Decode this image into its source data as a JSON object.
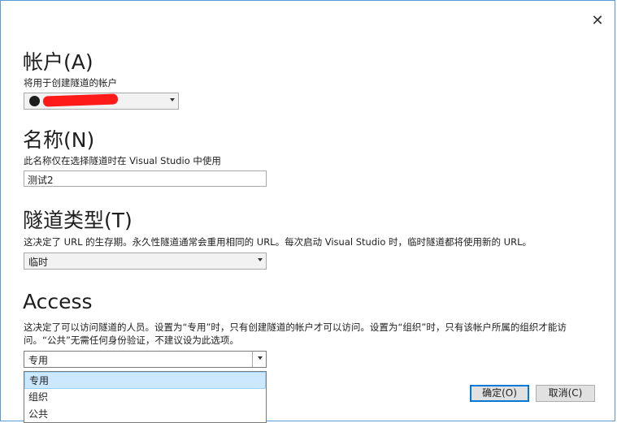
{
  "window": {
    "close_glyph": "✕"
  },
  "account": {
    "title": "帐户(A)",
    "desc": "将用于创建隧道的帐户",
    "value": "",
    "icon": "github-icon"
  },
  "name": {
    "title": "名称(N)",
    "desc": "此名称仅在选择隧道时在 Visual Studio 中使用",
    "value": "测试2"
  },
  "tunnel_type": {
    "title": "隧道类型(T)",
    "desc": "这决定了 URL 的生存期。永久性隧道通常会重用相同的 URL。每次启动 Visual Studio 时，临时隧道都将使用新的 URL。",
    "value": "临时"
  },
  "access": {
    "title": "Access",
    "desc_line1": "这决定了可以访问隧道的人员。设置为“专用”时，只有创建隧道的帐户才可以访问。设置为“组织”时，只有该帐户所属的组织才能访",
    "desc_line2": "问。“公共”无需任何身份验证，不建议设为此选项。",
    "value": "专用",
    "options": [
      "专用",
      "组织",
      "公共"
    ]
  },
  "buttons": {
    "ok": "确定(O)",
    "cancel": "取消(C)"
  }
}
